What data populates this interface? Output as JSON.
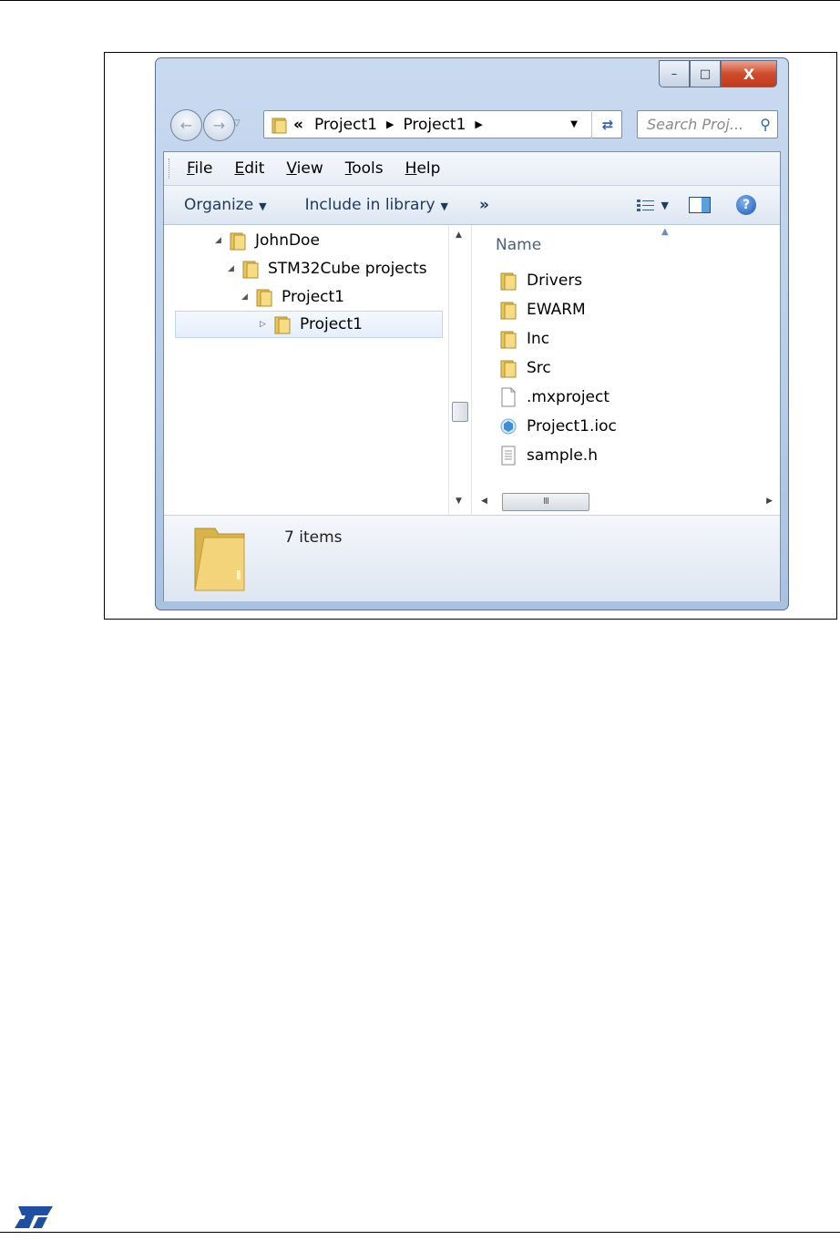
{
  "window": {
    "caption_minimize": "–",
    "caption_maximize": "□",
    "caption_close": "X"
  },
  "address_bar": {
    "overflow": "«",
    "crumbs": [
      "Project1",
      "Project1"
    ]
  },
  "search": {
    "placeholder": "Search Proj..."
  },
  "menu": {
    "items": [
      {
        "label": "ile",
        "accel": "F"
      },
      {
        "label": "dit",
        "accel": "E"
      },
      {
        "label": "iew",
        "accel": "V"
      },
      {
        "label": "ools",
        "accel": "T"
      },
      {
        "label": "elp",
        "accel": "H"
      }
    ]
  },
  "toolbar": {
    "organize": "Organize",
    "include_in_library": "Include in library",
    "more": "»"
  },
  "tree": {
    "items": [
      {
        "label": "JohnDoe",
        "expanded": true
      },
      {
        "label": "STM32Cube projects",
        "expanded": true
      },
      {
        "label": "Project1",
        "expanded": true
      },
      {
        "label": "Project1",
        "expanded": false,
        "selected": true
      }
    ]
  },
  "file_list": {
    "column_name": "Name",
    "items": [
      {
        "name": "Drivers",
        "icon": "folder-icon"
      },
      {
        "name": "EWARM",
        "icon": "folder-icon"
      },
      {
        "name": "Inc",
        "icon": "folder-icon"
      },
      {
        "name": "Src",
        "icon": "folder-icon"
      },
      {
        "name": ".mxproject",
        "icon": "blank-file-icon"
      },
      {
        "name": "Project1.ioc",
        "icon": "ioc-file-icon"
      },
      {
        "name": "sample.h",
        "icon": "text-file-icon"
      }
    ]
  },
  "status": {
    "item_count": "7 items"
  },
  "colors": {
    "accent": "#2c63b7",
    "close_button": "#c23a1c",
    "folder": "#e8c65a"
  }
}
